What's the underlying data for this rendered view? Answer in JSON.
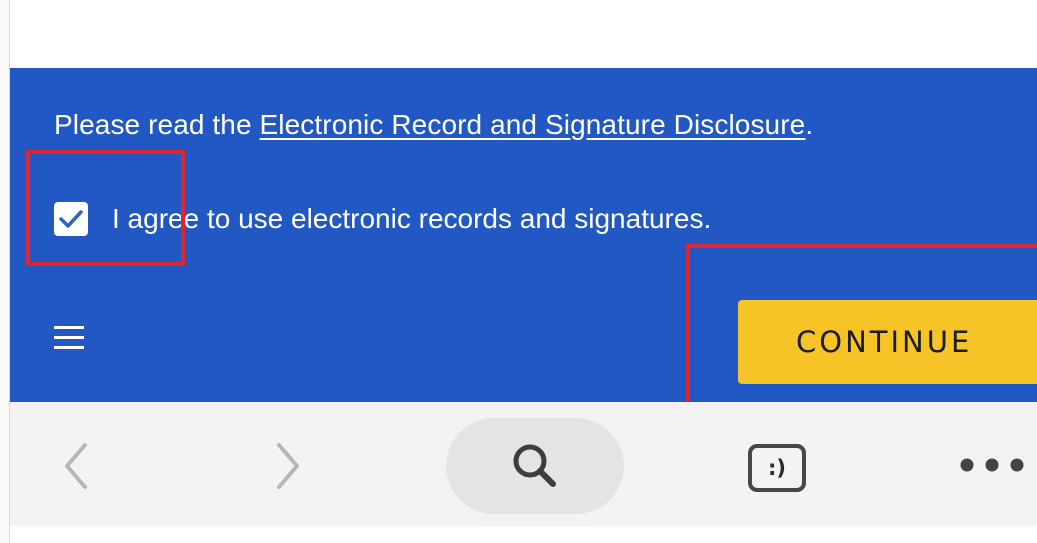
{
  "banner": {
    "disclosure_prefix": "Please read the ",
    "disclosure_link": "Electronic Record and Signature Disclosure",
    "disclosure_suffix": ".",
    "agree_label": "I agree to use electronic records and signatures.",
    "agree_checked": true,
    "continue_label": "CONTINUE",
    "background_color": "#2258c4",
    "continue_color": "#f6c427"
  },
  "annotations": {
    "highlight_color": "#e0252e"
  },
  "toolbar": {
    "back_icon": "chevron-left-icon",
    "forward_icon": "chevron-right-icon",
    "search_icon": "search-icon",
    "tabs_icon": "tabs-icon",
    "tabs_label": ":)",
    "more_icon": "more-icon"
  }
}
